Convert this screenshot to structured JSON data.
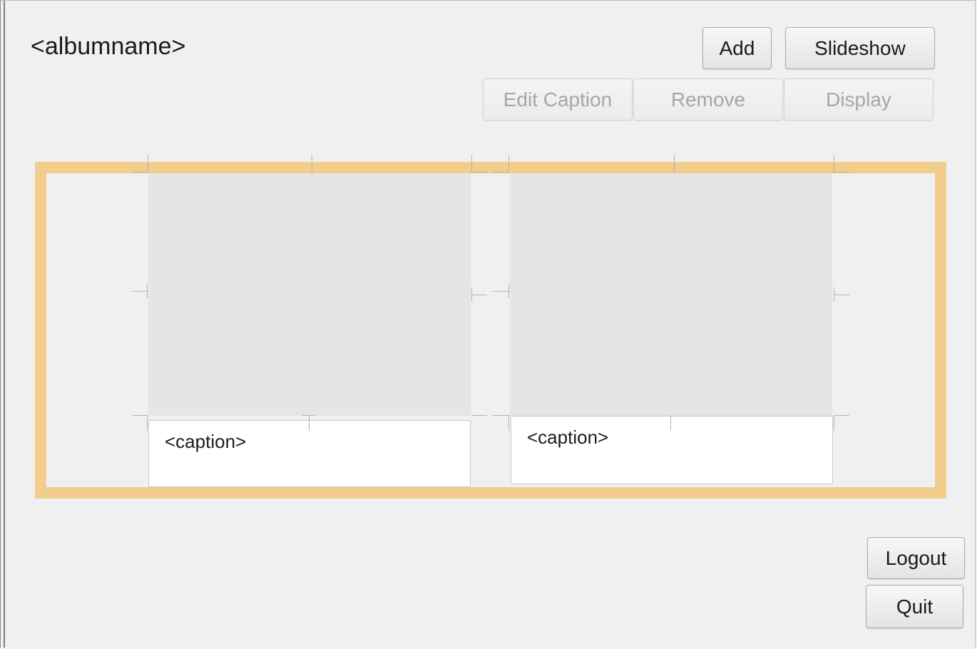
{
  "header": {
    "album_title": "<albumname>"
  },
  "toolbar": {
    "add_label": "Add",
    "slideshow_label": "Slideshow",
    "edit_caption_label": "Edit Caption",
    "remove_label": "Remove",
    "display_label": "Display"
  },
  "photos": [
    {
      "caption": "<caption>"
    },
    {
      "caption": "<caption>"
    }
  ],
  "footer": {
    "logout_label": "Logout",
    "quit_label": "Quit"
  },
  "colors": {
    "selection_border": "#f2cd8c",
    "background": "#f0f0f0",
    "image_placeholder": "#e5e5e5"
  }
}
